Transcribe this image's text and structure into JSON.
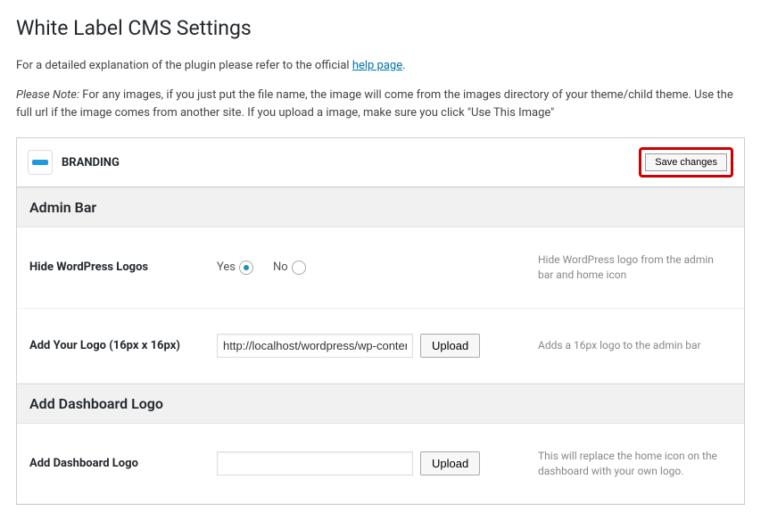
{
  "page": {
    "title": "White Label CMS Settings",
    "intro_text": "For a detailed explanation of the plugin please refer to the official ",
    "intro_link": "help page",
    "intro_suffix": ".",
    "note_prefix": "Please Note:",
    "note_body": " For any images, if you just put the file name, the image will come from the images directory of your theme/child theme. Use the full url if the image comes from another site. If you upload a image, make sure you click \"Use This Image\""
  },
  "header": {
    "title": "BRANDING",
    "save_label": "Save changes"
  },
  "sections": {
    "admin_bar": {
      "title": "Admin Bar",
      "hide_logos": {
        "label": "Hide WordPress Logos",
        "yes": "Yes",
        "no": "No",
        "selected": "yes",
        "help": "Hide WordPress logo from the admin bar and home icon"
      },
      "add_logo": {
        "label": "Add Your Logo (16px x 16px)",
        "value": "http://localhost/wordpress/wp-content/uploa",
        "upload_label": "Upload",
        "help": "Adds a 16px logo to the admin bar"
      }
    },
    "dashboard_logo": {
      "title": "Add Dashboard Logo",
      "add": {
        "label": "Add Dashboard Logo",
        "value": "",
        "upload_label": "Upload",
        "help": "This will replace the home icon on the dashboard with your own logo."
      }
    }
  }
}
